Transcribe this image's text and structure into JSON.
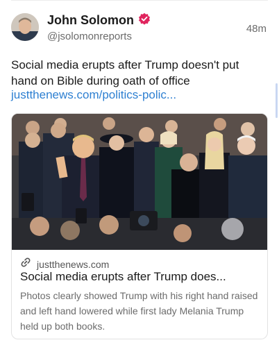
{
  "author": {
    "name": "John Solomon",
    "handle": "@jsolomonreports",
    "verified_badge_icon": "verified-badge-icon",
    "badge_color": "#e0245e"
  },
  "post": {
    "time": "48m",
    "text": "Social media erupts after Trump doesn't put hand on Bible during oath of office",
    "link_text": "justthenews.com/politics-polic..."
  },
  "link_card": {
    "domain": "justthenews.com",
    "link_icon": "link-icon",
    "title": "Social media erupts after Trump does...",
    "description": "Photos clearly showed Trump with his right hand raised and left hand lowered while first lady Melania Trump held up both books."
  },
  "colors": {
    "link": "#2d7fd1",
    "muted_text": "#6b6b6b"
  }
}
